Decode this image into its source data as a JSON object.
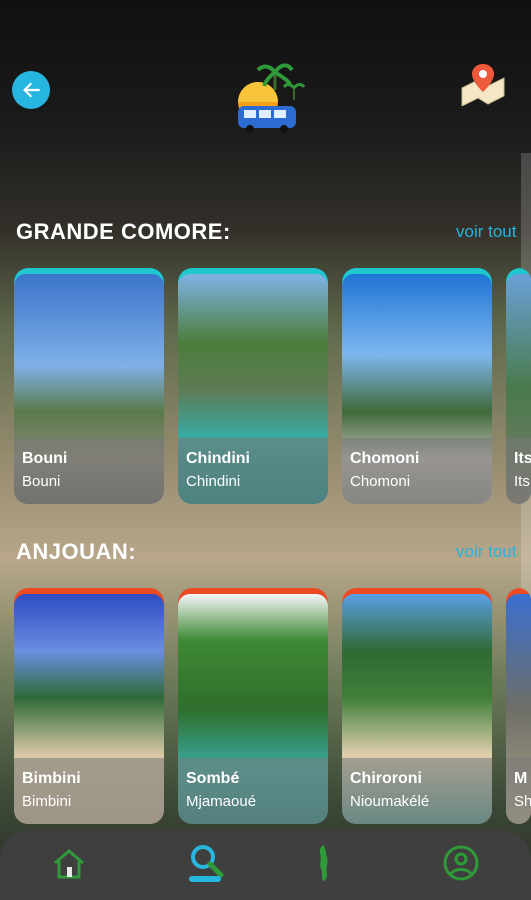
{
  "header": {
    "back_icon": "arrow-left-icon",
    "logo_icon": "bus-palm-logo-icon",
    "map_icon": "map-pin-icon"
  },
  "sections": [
    {
      "title": "GRANDE COMORE:",
      "see_all": "voir tout",
      "accent": "#1fc7cf",
      "cards": [
        {
          "name": "Bouni",
          "sub": "Bouni"
        },
        {
          "name": "Chindini",
          "sub": "Chindini"
        },
        {
          "name": "Chomoni",
          "sub": "Chomoni"
        },
        {
          "name": "Its",
          "sub": "Its"
        }
      ]
    },
    {
      "title": "ANJOUAN:",
      "see_all": "voir tout",
      "accent": "#ec4a22",
      "cards": [
        {
          "name": "Bimbini",
          "sub": "Bimbini"
        },
        {
          "name": "Sombé",
          "sub": "Mjamaoué"
        },
        {
          "name": "Chiroroni",
          "sub": "Nioumakélé"
        },
        {
          "name": "M",
          "sub": "Sh"
        }
      ]
    }
  ],
  "bottom_nav": {
    "items": [
      {
        "icon": "home-icon"
      },
      {
        "icon": "search-icon"
      },
      {
        "icon": "island-map-icon"
      },
      {
        "icon": "user-icon"
      }
    ],
    "active_color": "#26b6e0"
  }
}
